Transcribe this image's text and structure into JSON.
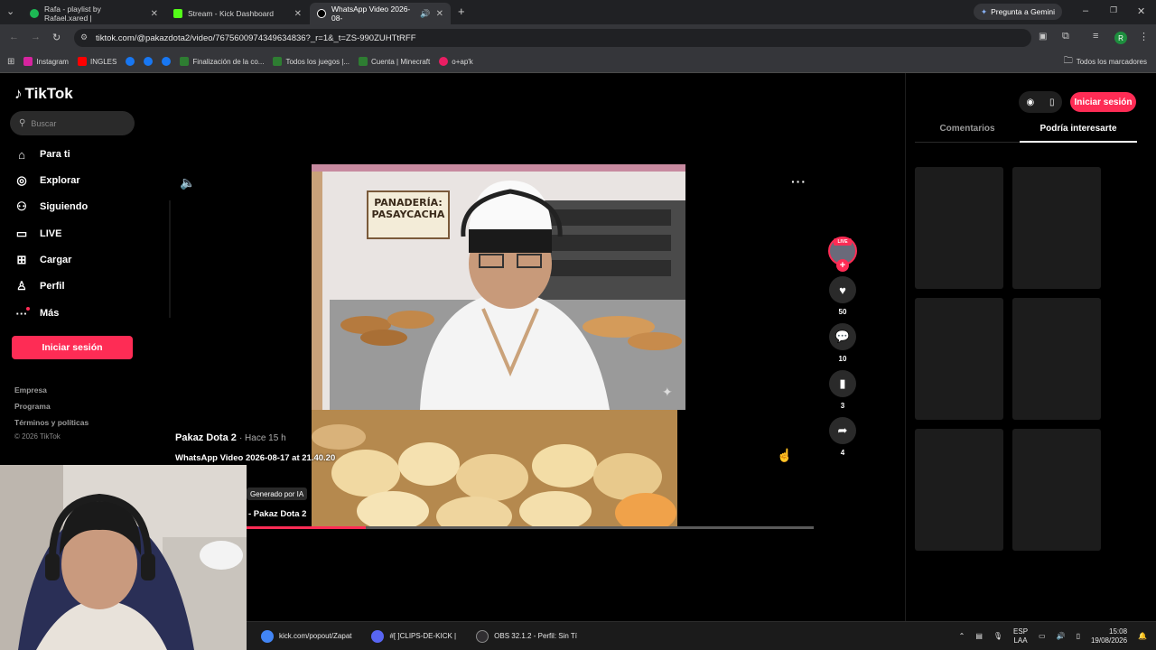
{
  "browser": {
    "tabs": [
      {
        "title": "Rafa - playlist by Rafael.xared |",
        "favicon_color": "#1db954"
      },
      {
        "title": "Stream - Kick Dashboard",
        "favicon_color": "#53fc18"
      },
      {
        "title": "WhatsApp Video 2026-08-",
        "favicon_color": "#000000"
      }
    ],
    "gemini_label": "Pregunta a Gemini",
    "url": "tiktok.com/@pakazdota2/video/7675600974349634836?_r=1&_t=ZS-990ZUHTtRFF",
    "profile_initial": "R",
    "bookmarks": [
      {
        "label": "Instagram",
        "color": "#d6249f"
      },
      {
        "label": "INGLES",
        "color": "#ff0000"
      },
      {
        "label": "",
        "color": "#1877f2"
      },
      {
        "label": "",
        "color": "#1877f2"
      },
      {
        "label": "",
        "color": "#1877f2"
      },
      {
        "label": "Finalización de la co...",
        "color": "#2e7d32"
      },
      {
        "label": "Todos los juegos |...",
        "color": "#2e7d32"
      },
      {
        "label": "Cuenta | Minecraft",
        "color": "#2e7d32"
      },
      {
        "label": "o+ap'k",
        "color": "#e91e63"
      }
    ],
    "all_bookmarks": "Todos los marcadores"
  },
  "tiktok": {
    "logo": "TikTok",
    "search_placeholder": "Buscar",
    "nav": [
      {
        "label": "Para ti",
        "icon": "home-icon"
      },
      {
        "label": "Explorar",
        "icon": "compass-icon"
      },
      {
        "label": "Siguiendo",
        "icon": "following-icon"
      },
      {
        "label": "LIVE",
        "icon": "live-icon"
      },
      {
        "label": "Cargar",
        "icon": "upload-icon"
      },
      {
        "label": "Perfil",
        "icon": "profile-icon"
      },
      {
        "label": "Más",
        "icon": "more-icon"
      }
    ],
    "login_label": "Iniciar sesión",
    "footer": {
      "company": "Empresa",
      "program": "Programa",
      "terms": "Términos y políticas",
      "copyright": "© 2026 TikTok"
    },
    "video": {
      "author": "Pakaz Dota 2",
      "time_ago": "· Hace 15 h",
      "caption": "WhatsApp Video 2026-08-17 at 21.40.20",
      "ai_label": "Generado por IA",
      "sound_label": "- Pakaz Dota 2",
      "sign_text_1": "PANADERÍA:",
      "sign_text_2": "PASAYCACHA",
      "progress": 0.21
    },
    "actions": {
      "live_badge": "LIVE",
      "likes": "50",
      "comments": "10",
      "saves": "3",
      "shares": "4"
    },
    "right_panel": {
      "login_label": "Iniciar sesión",
      "tab_comments": "Comentarios",
      "tab_interest": "Podría interesarte"
    }
  },
  "taskbar": {
    "items": [
      {
        "label": "kick.com/popout/Zapat",
        "color": "#4285f4"
      },
      {
        "label": "#[ ]CLIPS-DE-KICK |",
        "color": "#5865f2"
      },
      {
        "label": "OBS 32.1.2 - Perfil: Sin Tí",
        "color": "#302e31"
      }
    ],
    "lang_1": "ESP",
    "lang_2": "LAA",
    "time": "15:08",
    "date": "19/08/2026"
  }
}
